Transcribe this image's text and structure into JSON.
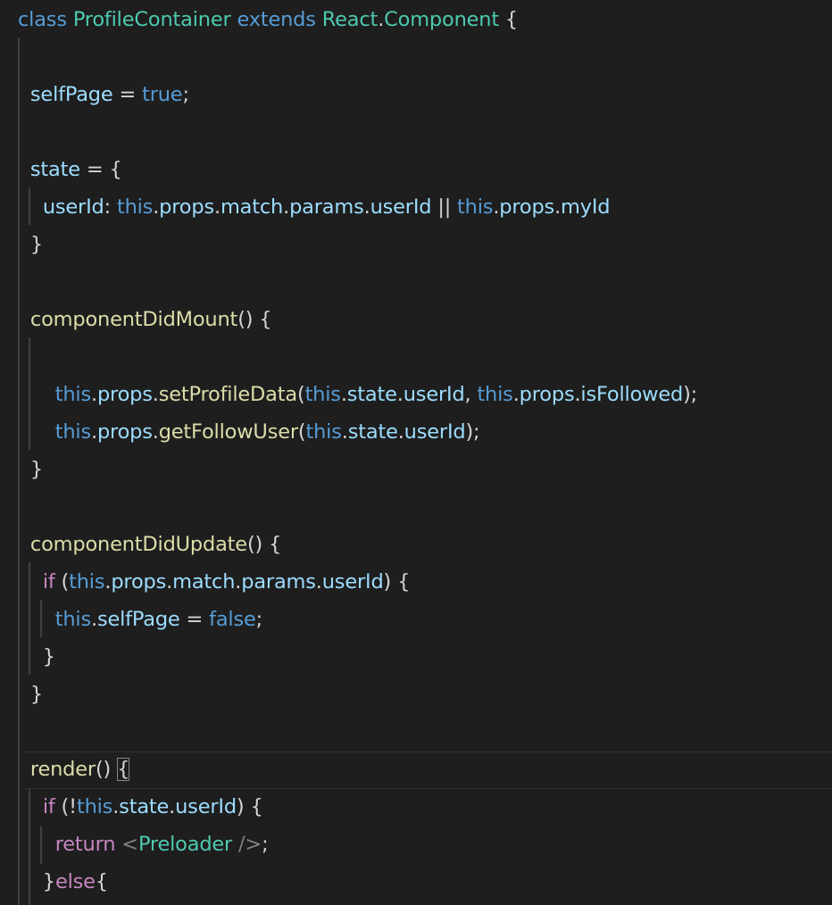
{
  "editor": {
    "colors": {
      "background": "#1e1e1e",
      "keyword": "#569cd6",
      "control": "#c586c0",
      "class": "#4ec9b0",
      "property": "#9cdcfe",
      "function": "#dcdcaa",
      "punctuation": "#d4d4d4"
    },
    "lines": [
      [
        {
          "t": "class",
          "c": "kw"
        },
        {
          "t": " "
        },
        {
          "t": "ProfileContainer",
          "c": "cls"
        },
        {
          "t": " "
        },
        {
          "t": "extends",
          "c": "kw"
        },
        {
          "t": " "
        },
        {
          "t": "React",
          "c": "cls"
        },
        {
          "t": "."
        },
        {
          "t": "Component",
          "c": "cls"
        },
        {
          "t": " {"
        }
      ],
      [],
      [
        {
          "t": "  "
        },
        {
          "t": "selfPage",
          "c": "prop"
        },
        {
          "t": " = "
        },
        {
          "t": "true",
          "c": "kw"
        },
        {
          "t": ";"
        }
      ],
      [],
      [
        {
          "t": "  "
        },
        {
          "t": "state",
          "c": "prop"
        },
        {
          "t": " = {"
        }
      ],
      [
        {
          "t": "    "
        },
        {
          "t": "userId",
          "c": "prop"
        },
        {
          "t": ": "
        },
        {
          "t": "this",
          "c": "kw"
        },
        {
          "t": "."
        },
        {
          "t": "props",
          "c": "prop"
        },
        {
          "t": "."
        },
        {
          "t": "match",
          "c": "prop"
        },
        {
          "t": "."
        },
        {
          "t": "params",
          "c": "prop"
        },
        {
          "t": "."
        },
        {
          "t": "userId",
          "c": "prop"
        },
        {
          "t": " || "
        },
        {
          "t": "this",
          "c": "kw"
        },
        {
          "t": "."
        },
        {
          "t": "props",
          "c": "prop"
        },
        {
          "t": "."
        },
        {
          "t": "myId",
          "c": "prop"
        }
      ],
      [
        {
          "t": "  }"
        }
      ],
      [],
      [
        {
          "t": "  "
        },
        {
          "t": "componentDidMount",
          "c": "fn"
        },
        {
          "t": "() {"
        }
      ],
      [],
      [
        {
          "t": "      "
        },
        {
          "t": "this",
          "c": "kw"
        },
        {
          "t": "."
        },
        {
          "t": "props",
          "c": "prop"
        },
        {
          "t": "."
        },
        {
          "t": "setProfileData",
          "c": "fn"
        },
        {
          "t": "("
        },
        {
          "t": "this",
          "c": "kw"
        },
        {
          "t": "."
        },
        {
          "t": "state",
          "c": "prop"
        },
        {
          "t": "."
        },
        {
          "t": "userId",
          "c": "prop"
        },
        {
          "t": ", "
        },
        {
          "t": "this",
          "c": "kw"
        },
        {
          "t": "."
        },
        {
          "t": "props",
          "c": "prop"
        },
        {
          "t": "."
        },
        {
          "t": "isFollowed",
          "c": "prop"
        },
        {
          "t": ");"
        }
      ],
      [
        {
          "t": "      "
        },
        {
          "t": "this",
          "c": "kw"
        },
        {
          "t": "."
        },
        {
          "t": "props",
          "c": "prop"
        },
        {
          "t": "."
        },
        {
          "t": "getFollowUser",
          "c": "fn"
        },
        {
          "t": "("
        },
        {
          "t": "this",
          "c": "kw"
        },
        {
          "t": "."
        },
        {
          "t": "state",
          "c": "prop"
        },
        {
          "t": "."
        },
        {
          "t": "userId",
          "c": "prop"
        },
        {
          "t": ");"
        }
      ],
      [
        {
          "t": "  }"
        }
      ],
      [],
      [
        {
          "t": "  "
        },
        {
          "t": "componentDidUpdate",
          "c": "fn"
        },
        {
          "t": "() {"
        }
      ],
      [
        {
          "t": "    "
        },
        {
          "t": "if",
          "c": "ctl"
        },
        {
          "t": " ("
        },
        {
          "t": "this",
          "c": "kw"
        },
        {
          "t": "."
        },
        {
          "t": "props",
          "c": "prop"
        },
        {
          "t": "."
        },
        {
          "t": "match",
          "c": "prop"
        },
        {
          "t": "."
        },
        {
          "t": "params",
          "c": "prop"
        },
        {
          "t": "."
        },
        {
          "t": "userId",
          "c": "prop"
        },
        {
          "t": ") {"
        }
      ],
      [
        {
          "t": "      "
        },
        {
          "t": "this",
          "c": "kw"
        },
        {
          "t": "."
        },
        {
          "t": "selfPage",
          "c": "prop"
        },
        {
          "t": " = "
        },
        {
          "t": "false",
          "c": "kw"
        },
        {
          "t": ";"
        }
      ],
      [
        {
          "t": "    }"
        }
      ],
      [
        {
          "t": "  }"
        }
      ],
      [],
      [
        {
          "t": "  "
        },
        {
          "t": "render",
          "c": "fn"
        },
        {
          "t": "() "
        },
        {
          "t": "{",
          "c": "match"
        }
      ],
      [
        {
          "t": "    "
        },
        {
          "t": "if",
          "c": "ctl"
        },
        {
          "t": " (!"
        },
        {
          "t": "this",
          "c": "kw"
        },
        {
          "t": "."
        },
        {
          "t": "state",
          "c": "prop"
        },
        {
          "t": "."
        },
        {
          "t": "userId",
          "c": "prop"
        },
        {
          "t": ") {"
        }
      ],
      [
        {
          "t": "      "
        },
        {
          "t": "return",
          "c": "ctl"
        },
        {
          "t": " "
        },
        {
          "t": "<",
          "c": "tag"
        },
        {
          "t": "Preloader",
          "c": "cls"
        },
        {
          "t": " "
        },
        {
          "t": "/>",
          "c": "tag"
        },
        {
          "t": ";"
        }
      ],
      [
        {
          "t": "    }"
        },
        {
          "t": "else",
          "c": "ctl"
        },
        {
          "t": "{"
        }
      ]
    ]
  }
}
